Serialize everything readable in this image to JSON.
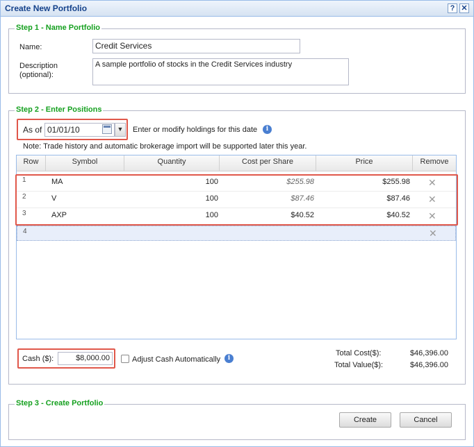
{
  "window": {
    "title": "Create New Portfolio",
    "help_glyph": "?",
    "close_glyph": "✕"
  },
  "step1": {
    "legend": "Step 1 - Name Portfolio",
    "name_label": "Name:",
    "name_value": "Credit Services",
    "description_label_line1": "Description",
    "description_label_line2": "(optional):",
    "description_value": "A sample portfolio of stocks in the Credit Services industry"
  },
  "step2": {
    "legend": "Step 2 - Enter Positions",
    "as_of_label": "As of",
    "date_value": "01/01/10",
    "date_hint": "Enter or modify holdings for this date",
    "note": "Note: Trade history and automatic brokerage import will be supported later this year.",
    "columns": [
      "Row",
      "Symbol",
      "Quantity",
      "Cost per Share",
      "Price",
      "Remove"
    ],
    "rows": [
      {
        "row": "1",
        "symbol": "MA",
        "quantity": "100",
        "cost": "$255.98",
        "price": "$255.98"
      },
      {
        "row": "2",
        "symbol": "V",
        "quantity": "100",
        "cost": "$87.46",
        "price": "$87.46"
      },
      {
        "row": "3",
        "symbol": "AXP",
        "quantity": "100",
        "cost": "$40.52",
        "price": "$40.52"
      },
      {
        "row": "4",
        "symbol": "",
        "quantity": "",
        "cost": "",
        "price": ""
      }
    ],
    "remove_glyph": "✕",
    "cash_label": "Cash ($):",
    "cash_value": "$8,000.00",
    "adjust_cash_label": "Adjust Cash Automatically",
    "total_cost_label": "Total Cost($):",
    "total_cost_value": "$46,396.00",
    "total_value_label": "Total Value($):",
    "total_value_value": "$46,396.00"
  },
  "step3": {
    "legend": "Step 3 - Create Portfolio",
    "create_label": "Create",
    "cancel_label": "Cancel"
  },
  "colors": {
    "legend_green": "#15a01f",
    "title_blue": "#15428b",
    "highlight_red": "#e0574a"
  },
  "icons": {
    "info": "info-icon",
    "calendar": "calendar-icon",
    "dropdown": "chevron-down-icon",
    "remove": "close-icon"
  }
}
